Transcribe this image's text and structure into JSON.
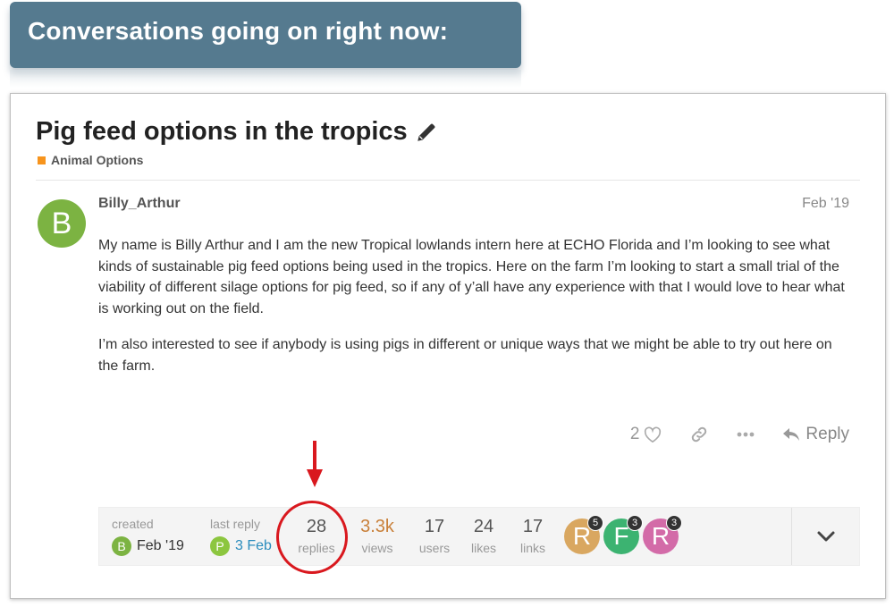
{
  "banner": {
    "text": "Conversations going on right now:"
  },
  "topic": {
    "title": "Pig feed options in the tropics",
    "category": "Animal Options",
    "category_color": "#f7941d"
  },
  "post": {
    "avatar_letter": "B",
    "avatar_color": "#7cb342",
    "username": "Billy_Arthur",
    "date": "Feb '19",
    "paragraphs": [
      "My name is Billy Arthur and I am the new Tropical lowlands intern here at ECHO Florida and I’m looking to see what kinds of sustainable pig feed options being used in the tropics. Here on the farm I’m looking to start a small trial of the viability of different silage options for pig feed, so if any of y’all have any experience with that I would love to hear what is working out on the field.",
      "I’m also interested to see if anybody is using pigs in different or unique ways that we might be able to try out here on the farm."
    ],
    "likes": "2",
    "reply_label": "Reply"
  },
  "meta": {
    "created_label": "created",
    "created_letter": "B",
    "created_date": "Feb '19",
    "last_reply_label": "last reply",
    "last_reply_letter": "P",
    "last_reply_date": "3 Feb",
    "stats": [
      {
        "value": "28",
        "label": "replies"
      },
      {
        "value": "3.3k",
        "label": "views"
      },
      {
        "value": "17",
        "label": "users"
      },
      {
        "value": "24",
        "label": "likes"
      },
      {
        "value": "17",
        "label": "links"
      }
    ],
    "participants": [
      {
        "letter": "R",
        "count": "5",
        "color": "#d9a760"
      },
      {
        "letter": "F",
        "count": "3",
        "color": "#3cb371"
      },
      {
        "letter": "R",
        "count": "3",
        "color": "#d36ba8"
      }
    ]
  },
  "icons": [
    "pencil-icon",
    "heart-icon",
    "link-icon",
    "more-icon",
    "reply-icon",
    "chevron-down-icon",
    "arrow-down-icon"
  ]
}
